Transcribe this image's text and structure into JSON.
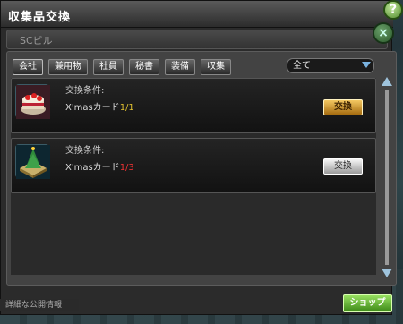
{
  "window": {
    "title": "収集品交換",
    "help_label": "?",
    "close_label": "×"
  },
  "section": {
    "title": "SCビル"
  },
  "tabs": [
    {
      "label": "会社"
    },
    {
      "label": "兼用物"
    },
    {
      "label": "社員"
    },
    {
      "label": "秘書"
    },
    {
      "label": "装備"
    },
    {
      "label": "収集"
    }
  ],
  "filter": {
    "selected": "全て"
  },
  "items": [
    {
      "condition_label": "交換条件:",
      "card_name": "X'masカード",
      "count": "1/1",
      "count_color": "#e0c030",
      "button_label": "交換",
      "button_state": "available",
      "icon": "cake-icon"
    },
    {
      "condition_label": "交換条件:",
      "card_name": "X'masカード",
      "count": "1/3",
      "count_color": "#e33333",
      "button_label": "交換",
      "button_state": "unavailable",
      "icon": "tree-island-icon"
    }
  ],
  "footer": {
    "note": "詳細な公開情報",
    "shop_label": "ショップ"
  }
}
